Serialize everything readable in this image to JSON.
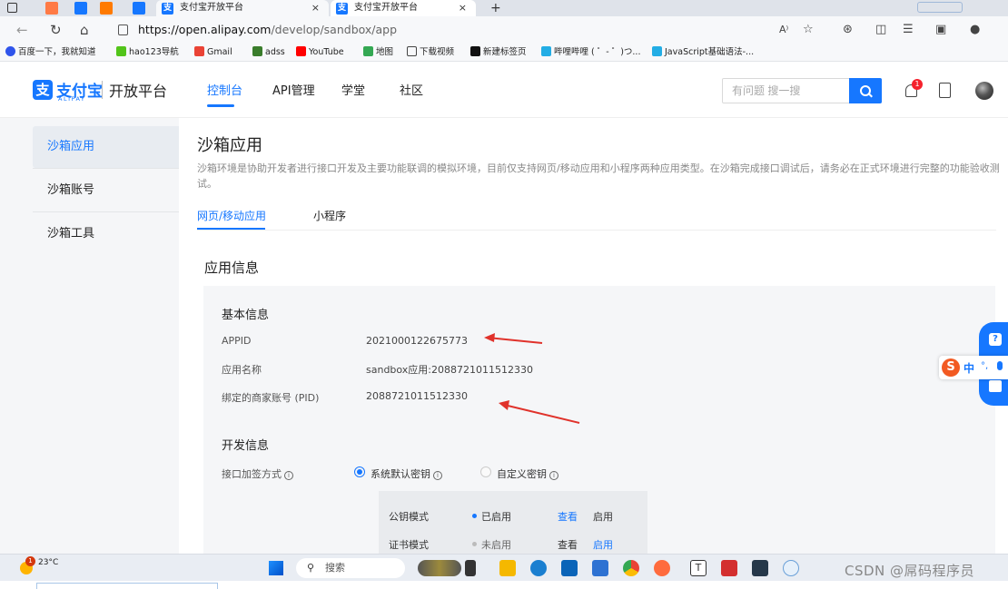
{
  "browser": {
    "tabs": [
      {
        "title": "支付宝开放平台",
        "close": "×"
      },
      {
        "title": "支付宝开放平台",
        "close": "×"
      }
    ],
    "new_tab": "+",
    "url_host": "https://open.alipay.com",
    "url_path": "/develop/sandbox/app",
    "bookmarks": [
      "百度一下，我就知道",
      "hao123导航",
      "Gmail",
      "adss",
      "YouTube",
      "地图",
      "下载视频",
      "新建标签页",
      "哔哩哔哩 ( ゜- ゜)つ...",
      "JavaScript基础语法-..."
    ]
  },
  "header": {
    "logo_text": "支付宝",
    "logo_sub": "ALIPAY",
    "platform": "开放平台",
    "nav": [
      "控制台",
      "API管理",
      "学堂",
      "社区"
    ],
    "search_placeholder": "有问题 搜一搜",
    "notification_count": "1"
  },
  "sidebar": {
    "items": [
      "沙箱应用",
      "沙箱账号",
      "沙箱工具"
    ]
  },
  "main": {
    "title": "沙箱应用",
    "description": "沙箱环境是协助开发者进行接口开发及主要功能联调的模拟环境，目前仅支持网页/移动应用和小程序两种应用类型。在沙箱完成接口调试后，请务必在正式环境进行完整的功能验收测试。",
    "tabs": [
      "网页/移动应用",
      "小程序"
    ],
    "section_title": "应用信息",
    "basic": {
      "heading": "基本信息",
      "rows": [
        {
          "label": "APPID",
          "value": "2021000122675773"
        },
        {
          "label": "应用名称",
          "value": "sandbox应用:2088721011512330"
        },
        {
          "label": "绑定的商家账号 (PID)",
          "value": "2088721011512330"
        }
      ]
    },
    "dev": {
      "heading": "开发信息",
      "sign_label": "接口加签方式",
      "options": [
        "系统默认密钥",
        "自定义密钥"
      ],
      "modes": [
        {
          "name": "公钥模式",
          "status": "已启用",
          "view": "查看",
          "action": "启用"
        },
        {
          "name": "证书模式",
          "status": "未启用",
          "view": "查看",
          "action": "启用"
        }
      ]
    }
  },
  "ime": {
    "lang": "中"
  },
  "taskbar": {
    "temperature": "23°C",
    "weather_badge": "1",
    "search": "搜索",
    "watermark": "CSDN @屌码程序员"
  },
  "colors": {
    "accent": "#1677ff",
    "annotation_arrow": "#e0322b"
  }
}
